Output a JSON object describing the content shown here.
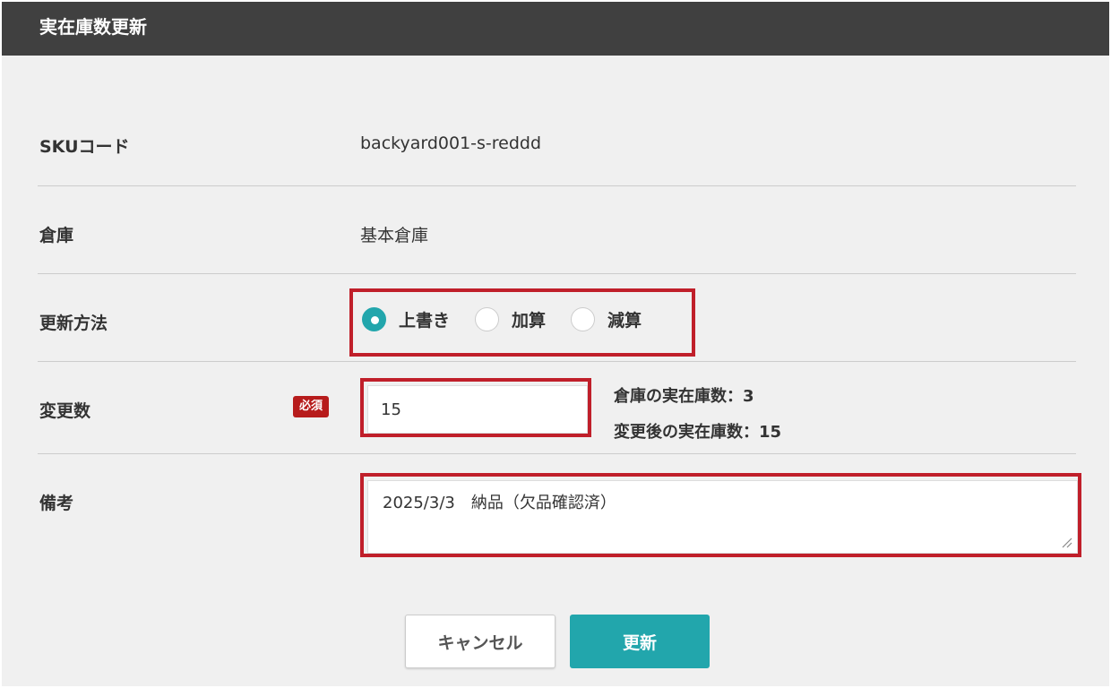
{
  "dialog": {
    "title": "実在庫数更新"
  },
  "fields": {
    "sku": {
      "label": "SKUコード",
      "value": "backyard001-s-reddd"
    },
    "warehouse": {
      "label": "倉庫",
      "value": "基本倉庫"
    },
    "method": {
      "label": "更新方法",
      "options": [
        {
          "label": "上書き",
          "checked": true
        },
        {
          "label": "加算",
          "checked": false
        },
        {
          "label": "減算",
          "checked": false
        }
      ]
    },
    "quantity": {
      "label": "変更数",
      "required_badge": "必須",
      "value": "15",
      "current_stock": "倉庫の実在庫数：3",
      "after_stock": "変更後の実在庫数：15"
    },
    "note": {
      "label": "備考",
      "value": "2025/3/3　納品（欠品確認済）"
    }
  },
  "buttons": {
    "cancel": "キャンセル",
    "update": "更新"
  },
  "colors": {
    "header_bg": "#404040",
    "accent": "#22a6ac",
    "highlight": "#c01f2a",
    "required": "#b71c1c"
  }
}
